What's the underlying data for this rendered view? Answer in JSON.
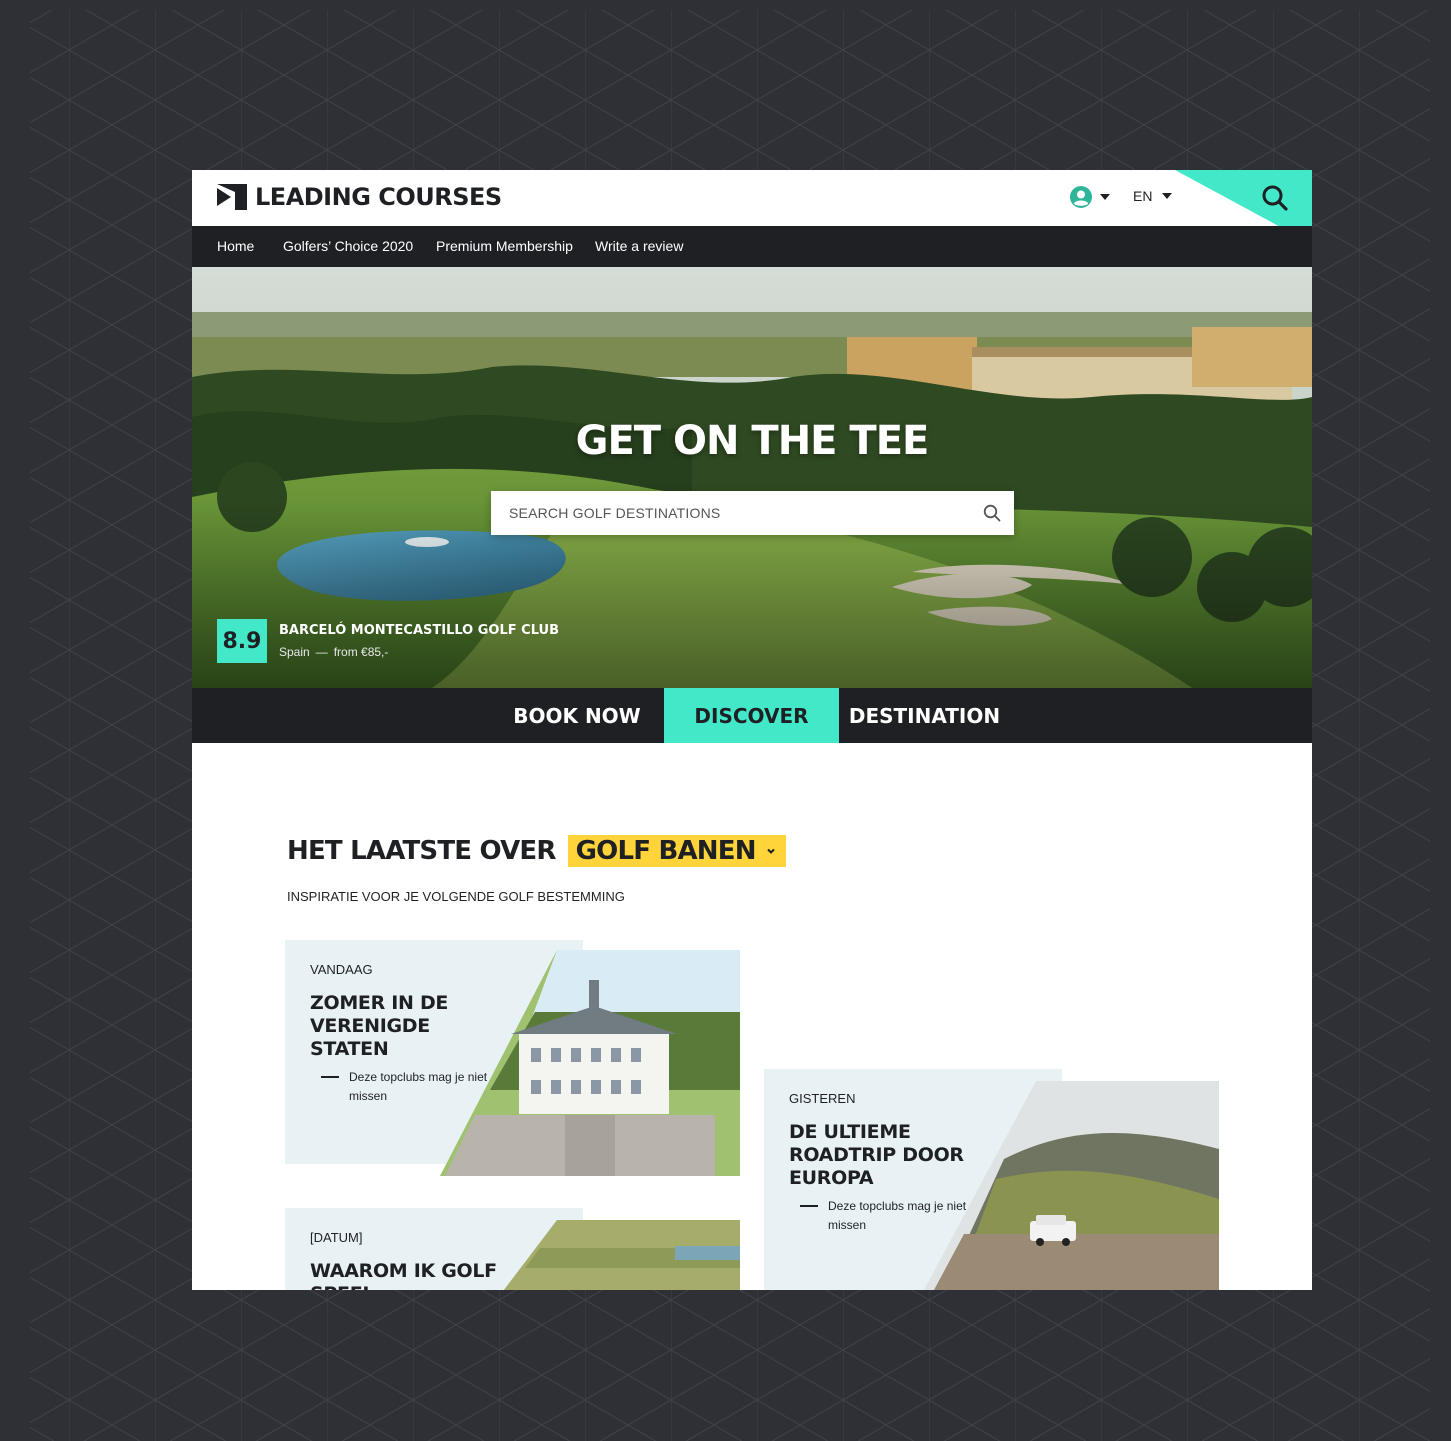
{
  "brand": {
    "name": "LEADING COURSES",
    "accent": "#43e8c9",
    "dark": "#1e2024",
    "highlight": "#ffd43a"
  },
  "header": {
    "language": "EN",
    "user_icon": "user-circle-icon",
    "search_icon": "search-icon"
  },
  "nav": {
    "items": [
      "Home",
      "Golfers’ Choice 2020",
      "Premium Membership",
      "Write a review"
    ]
  },
  "hero": {
    "title": "GET ON THE TEE",
    "search_placeholder": "SEARCH GOLF DESTINATIONS",
    "featured": {
      "score": "8.9",
      "name": "BARCELÓ MONTECASTILLO GOLF CLUB",
      "country": "Spain",
      "separator": "—",
      "price": "from €85,-"
    }
  },
  "tabs": [
    {
      "label": "BOOK NOW",
      "active": false
    },
    {
      "label": "DISCOVER",
      "active": true
    },
    {
      "label": "DESTINATION",
      "active": false
    }
  ],
  "latest": {
    "heading": "HET LAATSTE OVER",
    "topic": "GOLF BANEN",
    "subtitle": "INSPIRATIE VOOR JE VOLGENDE GOLF BESTEMMING",
    "articles": [
      {
        "date": "VANDAAG",
        "title": "ZOMER IN DE VERENIGDE STATEN",
        "excerpt": "Deze topclubs mag je niet missen"
      },
      {
        "date": "GISTEREN",
        "title": "DE ULTIEME ROADTRIP DOOR EUROPA",
        "excerpt": "Deze topclubs mag je niet missen"
      },
      {
        "date": "[DATUM]",
        "title": "WAAROM IK GOLF SPEEL"
      }
    ]
  }
}
